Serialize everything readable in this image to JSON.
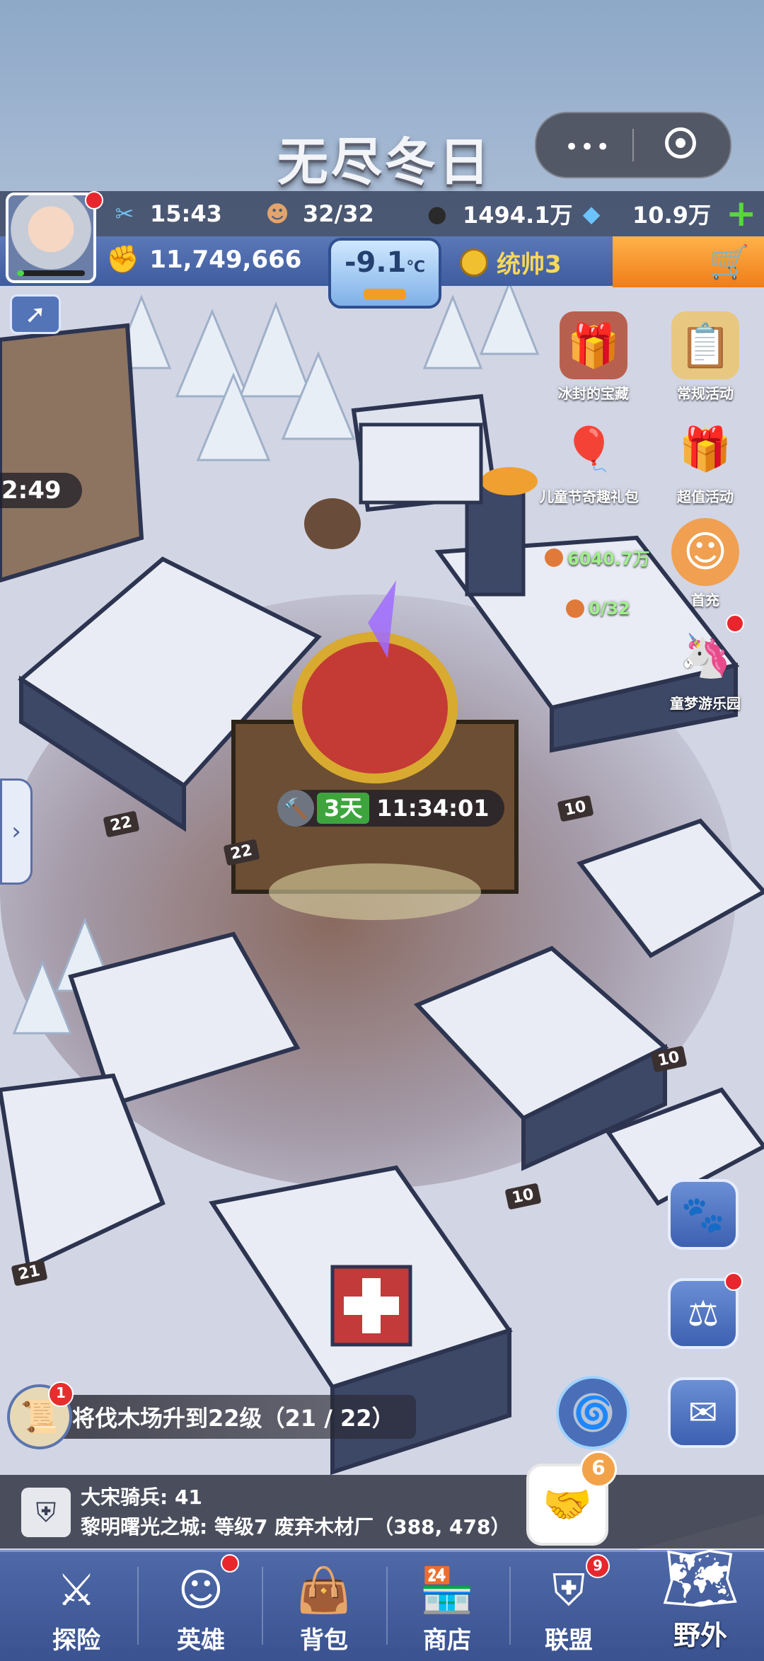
{
  "header": {
    "game_title": "无尽冬日",
    "capsule_more": "•••"
  },
  "resources": {
    "time": "15:43",
    "workers": "32/32",
    "coal": "1494.1万",
    "gems": "10.9万",
    "plus": "+"
  },
  "player": {
    "power": "11,749,666",
    "temperature": "-9.1",
    "temperature_unit": "℃",
    "rank": "统帅3"
  },
  "events": [
    {
      "label": "冰封的宝藏",
      "icon": "treasure-icon"
    },
    {
      "label": "常规活动",
      "icon": "clipboard-icon"
    },
    {
      "label": "儿童节奇趣礼包",
      "icon": "balloon-icon"
    },
    {
      "label": "超值活动",
      "icon": "gift-icon"
    },
    {
      "label": "首充",
      "icon": "hero-portrait-icon"
    },
    {
      "label": "童梦游乐园",
      "icon": "unicorn-icon"
    }
  ],
  "scene": {
    "left_timer": "2:49",
    "furnace_timer_days": "3天",
    "furnace_timer_time": "11:34:01",
    "food_amount": "6040.7万",
    "food_workers": "0/32",
    "levels": [
      "22",
      "22",
      "10",
      "10",
      "10",
      "21"
    ]
  },
  "quest": {
    "text": "将伐木场升到22级（21 / 22）",
    "badge": "1"
  },
  "chat": {
    "line1_name": "大宋骑兵:",
    "line1_value": "41",
    "line2": "黎明曙光之城: 等级7 废弃木材厂（388, 478）",
    "handshake_count": "6"
  },
  "nav": {
    "explore": "探险",
    "heroes": "英雄",
    "backpack": "背包",
    "shop": "商店",
    "alliance": "联盟",
    "alliance_badge": "9",
    "wild": "野外"
  },
  "colors": {
    "accent_blue": "#4f69a8",
    "green_plus": "#59d63e",
    "red_badge": "#e9262d",
    "gold_rank": "#f8d85a"
  }
}
